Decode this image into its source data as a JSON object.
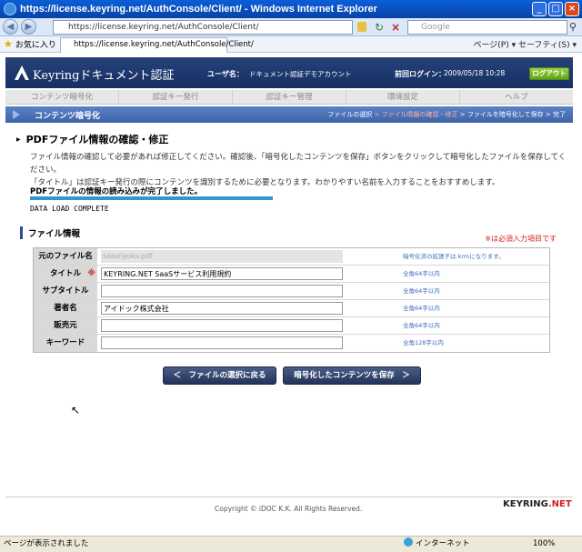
{
  "browser": {
    "window_title": "https://license.keyring.net/AuthConsole/Client/ - Windows Internet Explorer",
    "url": "https://license.keyring.net/AuthConsole/Client/",
    "search_placeholder": "Google",
    "favorites_label": "お気に入り",
    "tab_title": "https://license.keyring.net/AuthConsole/Client/",
    "tools_label": "ページ(P) ▾  セーフティ(S) ▾",
    "status_text": "ページが表示されました",
    "zone": "インターネット",
    "zoom": "100%"
  },
  "header": {
    "logo_text": "Keyringドキュメント認証",
    "user_label": "ユーザ名：",
    "user_value": "ドキュメント認証デモアカウント",
    "last_login_label": "前回ログイン：",
    "last_login_value": "2009/05/18 10:28",
    "logout_label": "ログアウト"
  },
  "menu": [
    "コンテンツ暗号化",
    "認証キー発行",
    "認証キー管理",
    "環境設定",
    "ヘルプ"
  ],
  "breadcrumb": {
    "title": "コンテンツ暗号化",
    "step1": "ファイルの選択",
    "step2": "ファイル情報の確認・修正",
    "step3": "ファイルを暗号化して保存",
    "step4": "完了"
  },
  "main": {
    "title": "PDFファイル情報の確認・修正",
    "desc1": "ファイル情報の確認して必要があれば修正してください。確認後、「暗号化したコンテンツを保存」ボタンをクリックして暗号化したファイルを保存してください。",
    "desc2": "「タイトル」は認証キー発行の際にコンテンツを識別するために必要となります。わかりやすい名前を入力することをおすすめします。",
    "load_title": "PDFファイルの情報の読み込みが完了しました。",
    "load_progress": 1.0,
    "load_status": "DATA LOAD COMPLETE",
    "file_heading": "ファイル情報",
    "required_note": "※は必須入力項目です"
  },
  "form": {
    "original_label": "元のファイル名",
    "original_value": "saasriyoku.pdf",
    "original_hint": "暗号化済の拡張子は.krmになります。",
    "title_label": "タイトル",
    "title_required": "※",
    "title_value": "KEYRING.NET SaaSサービス利用規約",
    "title_hint": "全角64字以内",
    "subtitle_label": "サブタイトル",
    "subtitle_value": "",
    "subtitle_hint": "全角64字以内",
    "author_label": "著者名",
    "author_value": "アイドック株式会社",
    "author_hint": "全角64字以内",
    "publisher_label": "販売元",
    "publisher_value": "",
    "publisher_hint": "全角64字以内",
    "keyword_label": "キーワード",
    "keyword_value": "",
    "keyword_hint": "全角128字以内"
  },
  "actions": {
    "back_label": "＜　ファイルの選択に戻る",
    "save_label": "暗号化したコンテンツを保存　＞"
  },
  "footer": {
    "copyright": "Copyright © iDOC K.K. All Rights Reserved.",
    "logo_part1": "KEYRING",
    "logo_part2": ".NET"
  }
}
